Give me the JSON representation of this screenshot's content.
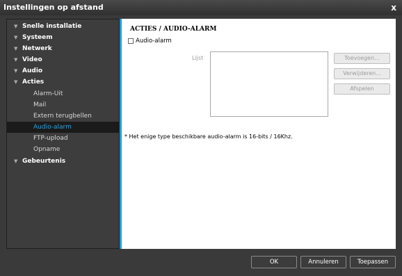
{
  "window": {
    "title": "Instellingen op afstand",
    "close_label": "x"
  },
  "sidebar": {
    "items": [
      {
        "label": "Snelle installatie",
        "level": 0
      },
      {
        "label": "Systeem",
        "level": 0
      },
      {
        "label": "Netwerk",
        "level": 0
      },
      {
        "label": "Video",
        "level": 0
      },
      {
        "label": "Audio",
        "level": 0
      },
      {
        "label": "Acties",
        "level": 0
      },
      {
        "label": "Alarm-Uit",
        "level": 1
      },
      {
        "label": "Mail",
        "level": 1
      },
      {
        "label": "Extern terugbellen",
        "level": 1
      },
      {
        "label": "Audio-alarm",
        "level": 1,
        "active": true
      },
      {
        "label": "FTP-upload",
        "level": 1
      },
      {
        "label": "Opname",
        "level": 1
      },
      {
        "label": "Gebeurtenis",
        "level": 0
      }
    ],
    "expander_glyph": "▼"
  },
  "main": {
    "heading": "ACTIES / AUDIO-ALARM",
    "audio_alarm_checkbox": {
      "label": "Audio-alarm",
      "checked": false
    },
    "list_label": "Lijst",
    "buttons": {
      "add": "Toevoegen...",
      "remove": "Verwijderen...",
      "play": "Afspelen"
    },
    "note": "* Het enige type beschikbare audio-alarm is 16-bits / 16Khz."
  },
  "footer": {
    "ok": "OK",
    "cancel": "Annuleren",
    "apply": "Toepassen"
  },
  "colors": {
    "accent": "#1fa0d8",
    "active_text": "#2e9fd8",
    "sidebar_bg": "#3d3d3d",
    "window_bg": "#3a3a3a"
  }
}
